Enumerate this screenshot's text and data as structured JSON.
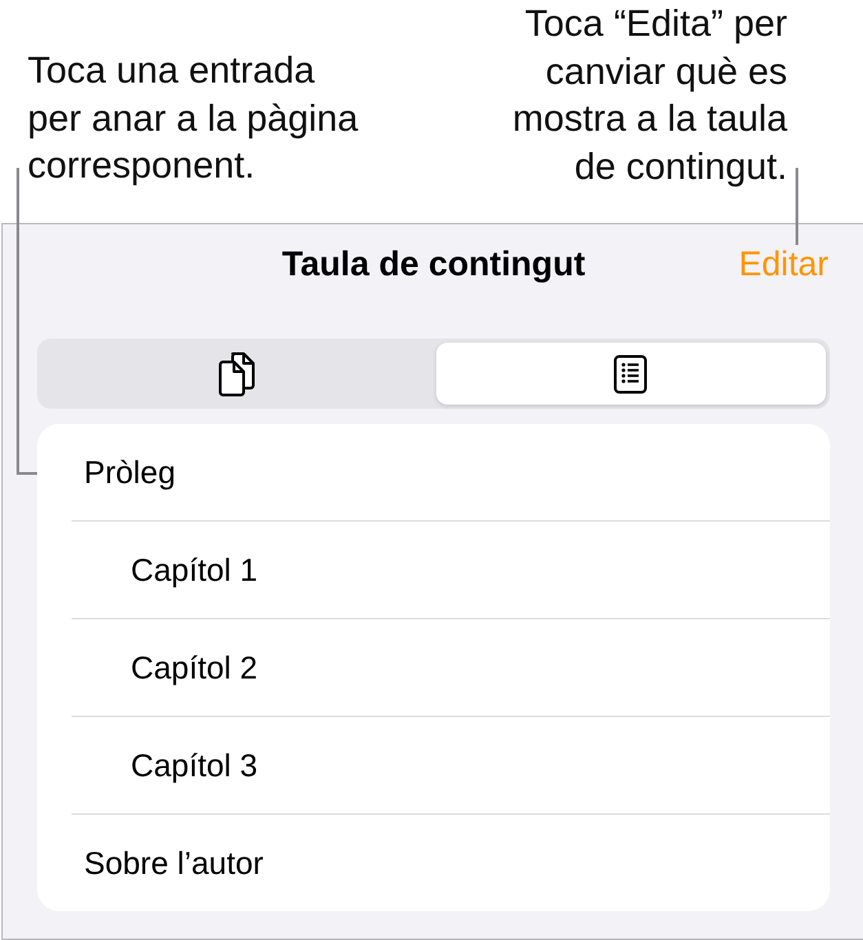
{
  "callouts": [
    {
      "lines": [
        "Toca una entrada",
        "per anar a la pàgina",
        "corresponent."
      ]
    },
    {
      "lines": [
        "Toca “Edita” per",
        "canviar què es",
        "mostra a la taula",
        "de contingut."
      ]
    }
  ],
  "panel": {
    "title": "Taula de contingut",
    "edit_button": "Editar",
    "view_tabs": [
      {
        "selected": false
      },
      {
        "selected": true
      }
    ],
    "entries": [
      {
        "label": "Pròleg",
        "children": [
          {
            "label": "Capítol 1"
          },
          {
            "label": "Capítol 2"
          },
          {
            "label": "Capítol 3"
          }
        ]
      },
      {
        "label": "Sobre l’autor"
      }
    ]
  }
}
